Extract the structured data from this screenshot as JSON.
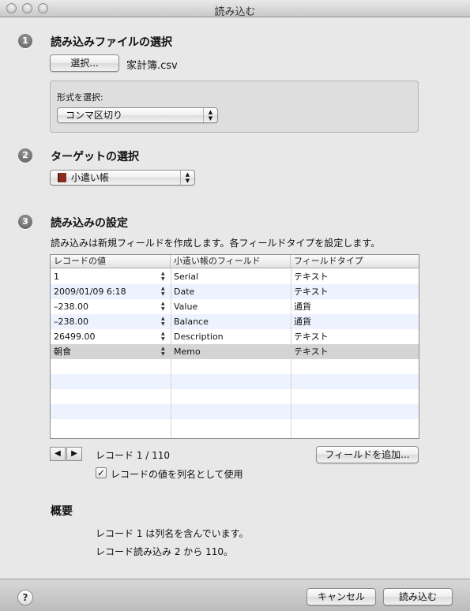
{
  "window": {
    "title": "読み込む"
  },
  "section1": {
    "number": "1",
    "heading": "読み込みファイルの選択",
    "choose_button": "選択...",
    "filename": "家計簿.csv",
    "format_label": "形式を選択:",
    "format_value": "コンマ区切り"
  },
  "section2": {
    "number": "2",
    "heading": "ターゲットの選択",
    "target_value": "小遣い帳",
    "target_icon": "book-icon"
  },
  "section3": {
    "number": "3",
    "heading": "読み込みの設定",
    "description": "読み込みは新規フィールドを作成します。各フィールドタイプを設定します。",
    "columns": [
      "レコードの値",
      "小遣い帳のフィールド",
      "フィールドタイプ"
    ],
    "rows": [
      {
        "value": "1",
        "field": "Serial",
        "type": "テキスト"
      },
      {
        "value": "2009/01/09 6:18",
        "field": "Date",
        "type": "テキスト"
      },
      {
        "value": "–238.00",
        "field": "Value",
        "type": "通貨"
      },
      {
        "value": "–238.00",
        "field": "Balance",
        "type": "通貨"
      },
      {
        "value": "26499.00",
        "field": "Description",
        "type": "テキスト"
      },
      {
        "value": "朝食",
        "field": "Memo",
        "type": "テキスト"
      }
    ],
    "record_label": "レコード 1 / 110",
    "add_field_button": "フィールドを追加...",
    "use_as_names_label": "レコードの値を列名として使用",
    "use_as_names_checked": true
  },
  "summary": {
    "heading": "概要",
    "line1": "レコード 1 は列名を含んでいます。",
    "line2": "レコード読み込み 2 から 110。"
  },
  "footer": {
    "help": "?",
    "cancel_button": "キャンセル",
    "import_button": "読み込む"
  },
  "colors": {
    "window_bg": "#e8e8e8",
    "alt_row": "#edf3fe",
    "selected_row": "#d4d4d4",
    "book_icon": "#8b2a1e"
  }
}
